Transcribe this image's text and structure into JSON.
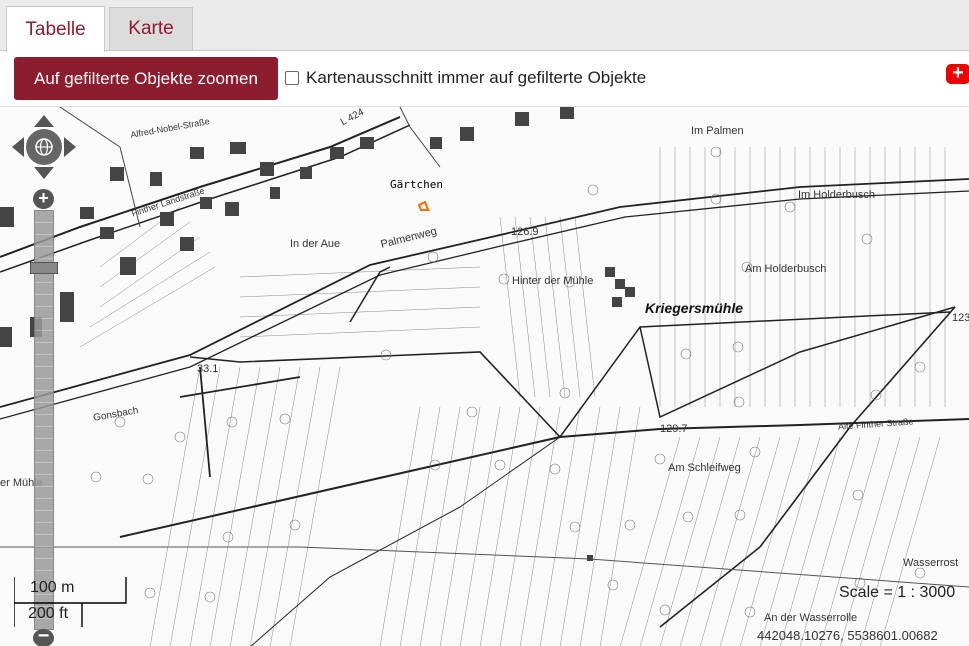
{
  "tabs": [
    {
      "label": "Tabelle",
      "active": true
    },
    {
      "label": "Karte",
      "active": false
    }
  ],
  "toolbar": {
    "zoom_button_label": "Auf gefilterte Objekte zoomen",
    "checkbox_label": "Kartenausschnitt immer auf gefilterte Objekte",
    "checkbox_checked": false,
    "add_icon": "plus-icon"
  },
  "map": {
    "labels": {
      "gaertchen": "Gärtchen",
      "kriegersmuehle": "Kriegersmühle",
      "im_palmen": "Im Palmen",
      "im_holderbusch": "Im Holderbusch",
      "am_holderbusch": "Am Holderbusch",
      "hinter_der_muehle": "Hinter der Mühle",
      "in_der_aue": "In der Aue",
      "palmenweg": "Palmenweg",
      "alfred_nobel": "Alfred-Nobel-Straße",
      "finther_landstrasse": "Finther Landstraße",
      "alte_finther_strasse": "Alte Finther Straße",
      "am_schleifweg": "Am Schleifweg",
      "an_der_wasserrolle": "An der Wasserrolle",
      "wasserrost": "Wasserrost",
      "gonsbach": "Gonsbach",
      "muehle_left": "er Mühle",
      "l424": "L 424",
      "elev_1269": "126.9",
      "elev_1297": "129.7",
      "elev_331": "33.1",
      "elev_123": "123"
    },
    "scale_m": "100 m",
    "scale_ft": "200 ft",
    "scale_text": "Scale = 1 : 3000",
    "coordinates": "442048.10276, 5538601.00682",
    "highlight_color": "#ff6a00",
    "accent_color": "#8b1d2f"
  }
}
